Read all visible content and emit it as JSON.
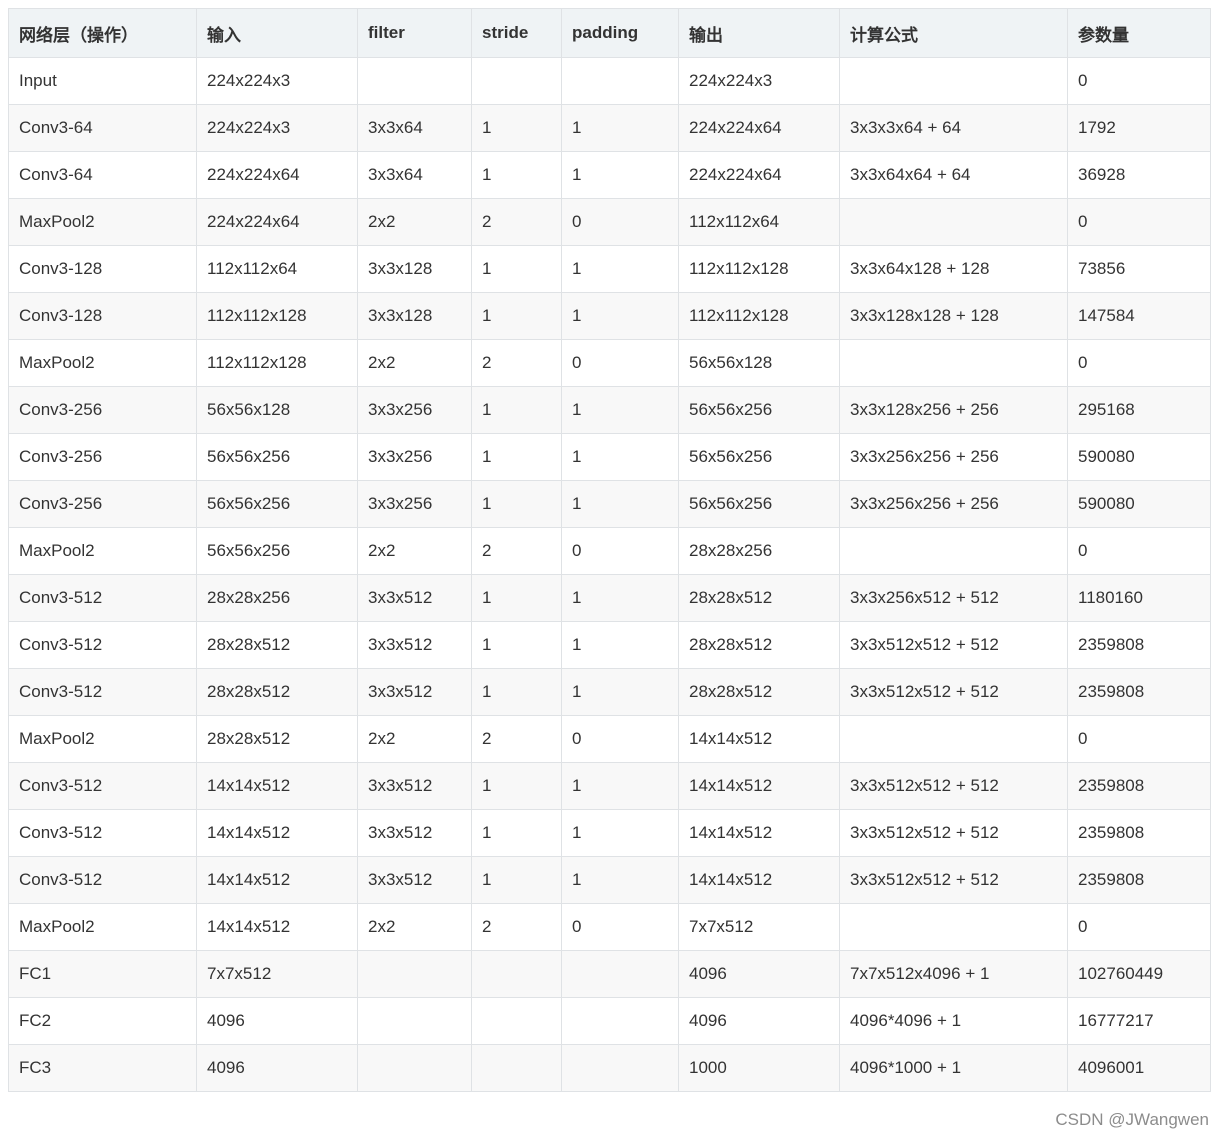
{
  "table": {
    "headers": [
      "网络层（操作）",
      "输入",
      "filter",
      "stride",
      "padding",
      "输出",
      "计算公式",
      "参数量"
    ],
    "rows": [
      [
        "Input",
        "224x224x3",
        "",
        "",
        "",
        "224x224x3",
        "",
        "0"
      ],
      [
        "Conv3-64",
        "224x224x3",
        "3x3x64",
        "1",
        "1",
        "224x224x64",
        "3x3x3x64 + 64",
        "1792"
      ],
      [
        "Conv3-64",
        "224x224x64",
        "3x3x64",
        "1",
        "1",
        "224x224x64",
        "3x3x64x64 + 64",
        "36928"
      ],
      [
        "MaxPool2",
        "224x224x64",
        "2x2",
        "2",
        "0",
        "112x112x64",
        "",
        "0"
      ],
      [
        "Conv3-128",
        "112x112x64",
        "3x3x128",
        "1",
        "1",
        "112x112x128",
        "3x3x64x128 + 128",
        "73856"
      ],
      [
        "Conv3-128",
        "112x112x128",
        "3x3x128",
        "1",
        "1",
        "112x112x128",
        "3x3x128x128 + 128",
        "147584"
      ],
      [
        "MaxPool2",
        "112x112x128",
        "2x2",
        "2",
        "0",
        "56x56x128",
        "",
        "0"
      ],
      [
        "Conv3-256",
        "56x56x128",
        "3x3x256",
        "1",
        "1",
        "56x56x256",
        "3x3x128x256 + 256",
        "295168"
      ],
      [
        "Conv3-256",
        "56x56x256",
        "3x3x256",
        "1",
        "1",
        "56x56x256",
        "3x3x256x256 + 256",
        "590080"
      ],
      [
        "Conv3-256",
        "56x56x256",
        "3x3x256",
        "1",
        "1",
        "56x56x256",
        "3x3x256x256 + 256",
        "590080"
      ],
      [
        "MaxPool2",
        "56x56x256",
        "2x2",
        "2",
        "0",
        "28x28x256",
        "",
        "0"
      ],
      [
        "Conv3-512",
        "28x28x256",
        "3x3x512",
        "1",
        "1",
        "28x28x512",
        "3x3x256x512 + 512",
        "1180160"
      ],
      [
        "Conv3-512",
        "28x28x512",
        "3x3x512",
        "1",
        "1",
        "28x28x512",
        "3x3x512x512 + 512",
        "2359808"
      ],
      [
        "Conv3-512",
        "28x28x512",
        "3x3x512",
        "1",
        "1",
        "28x28x512",
        "3x3x512x512 + 512",
        "2359808"
      ],
      [
        "MaxPool2",
        "28x28x512",
        "2x2",
        "2",
        "0",
        "14x14x512",
        "",
        "0"
      ],
      [
        "Conv3-512",
        "14x14x512",
        "3x3x512",
        "1",
        "1",
        "14x14x512",
        "3x3x512x512 + 512",
        "2359808"
      ],
      [
        "Conv3-512",
        "14x14x512",
        "3x3x512",
        "1",
        "1",
        "14x14x512",
        "3x3x512x512 + 512",
        "2359808"
      ],
      [
        "Conv3-512",
        "14x14x512",
        "3x3x512",
        "1",
        "1",
        "14x14x512",
        "3x3x512x512 + 512",
        "2359808"
      ],
      [
        "MaxPool2",
        "14x14x512",
        "2x2",
        "2",
        "0",
        "7x7x512",
        "",
        "0"
      ],
      [
        "FC1",
        "7x7x512",
        "",
        "",
        "",
        "4096",
        "7x7x512x4096 + 1",
        "102760449"
      ],
      [
        "FC2",
        "4096",
        "",
        "",
        "",
        "4096",
        "4096*4096 + 1",
        "16777217"
      ],
      [
        "FC3",
        "4096",
        "",
        "",
        "",
        "1000",
        "4096*1000 + 1",
        "4096001"
      ]
    ]
  },
  "watermark": "CSDN @JWangwen"
}
